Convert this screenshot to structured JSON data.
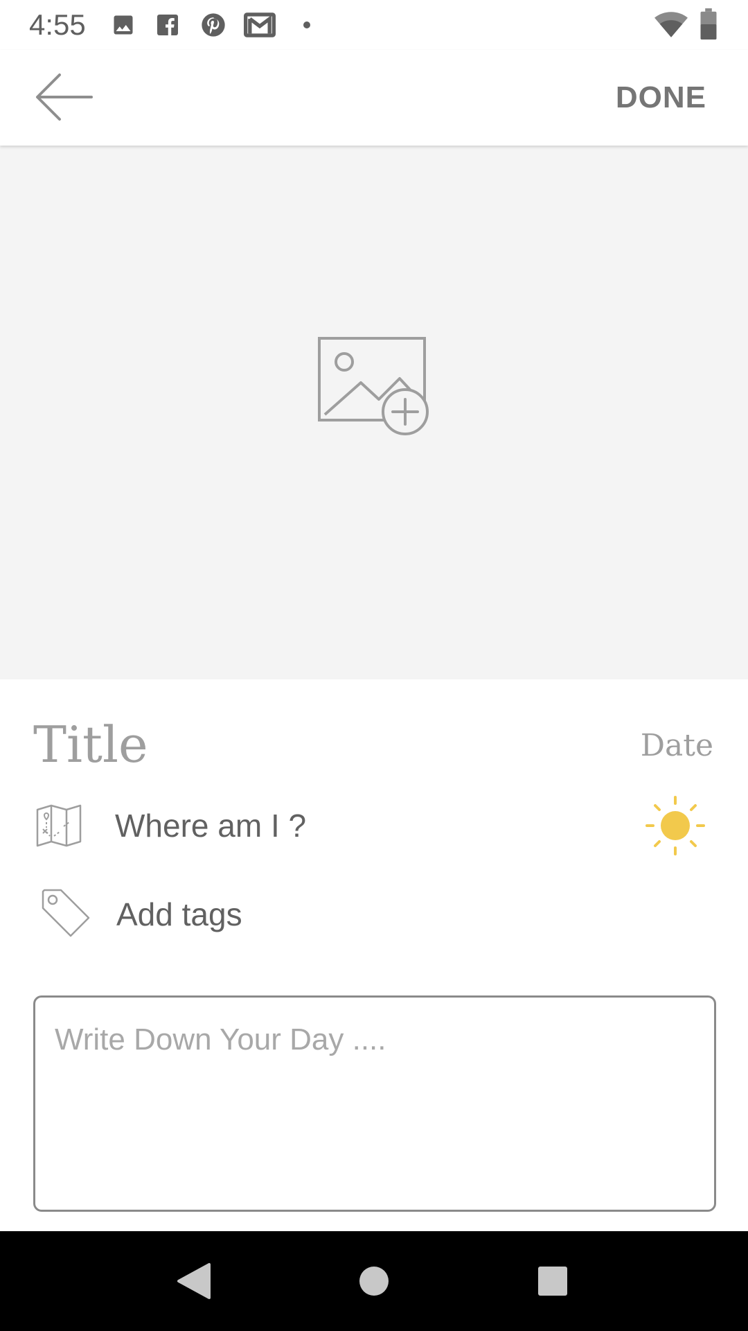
{
  "status_bar": {
    "time": "4:55",
    "notification_icons": [
      "image-icon",
      "facebook-icon",
      "pinterest-icon",
      "gmail-icon",
      "dot-icon"
    ],
    "system_icons": [
      "wifi-icon",
      "battery-icon"
    ]
  },
  "app_bar": {
    "back_icon": "arrow-left-icon",
    "done_label": "DONE"
  },
  "image_area": {
    "icon": "add-image-icon"
  },
  "entry": {
    "title_placeholder": "Title",
    "date_label": "Date",
    "location_label": "Where am I ?",
    "tags_label": "Add tags",
    "body_placeholder": "Write Down Your Day ...."
  },
  "colors": {
    "accent_sun": "#F2C94C",
    "muted_text": "#9E9E9E",
    "label_text": "#616161",
    "image_bg": "#F4F4F4"
  },
  "nav_bar": {
    "buttons": [
      "back-triangle-icon",
      "home-circle-icon",
      "recents-square-icon"
    ]
  }
}
